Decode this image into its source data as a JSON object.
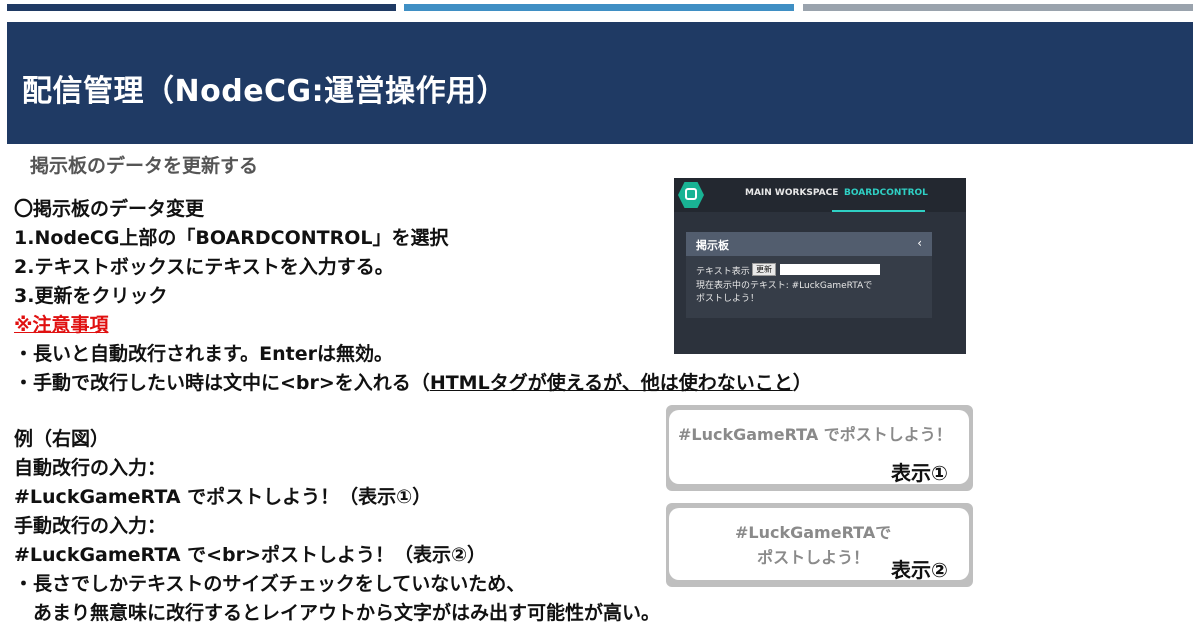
{
  "slide": {
    "title": "配信管理（NodeCG:運営操作用）",
    "subtitle": "掲示板のデータを更新する",
    "section_heading": "〇掲示板のデータ変更",
    "step1": "1.NodeCG上部の「BOARDCONTROL」を選択",
    "step2": "2.テキストボックスにテキストを入力する。",
    "step3": "3.更新をクリック",
    "caution": "※注意事項",
    "note1": "・長いと自動改行されます。Enterは無効。",
    "note2_prefix": "・手動で改行したい時は文中に<br>を入れる（",
    "note2_underlined": "HTMLタグが使えるが、他は使わないこと",
    "note2_suffix": "）",
    "example_heading": "例（右図）",
    "auto_label": "自動改行の入力：",
    "auto_input": "#LuckGameRTA でポストしよう！（表示①）",
    "manual_label": "手動改行の入力：",
    "manual_input": "#LuckGameRTA で<br>ポストしよう！（表示②）",
    "note3": "・長さでしかテキストのサイズチェックをしていないため、",
    "note4": "　あまり無意味に改行するとレイアウトから文字がはみ出す可能性が高い。"
  },
  "nodecg": {
    "tab_main": "MAIN WORKSPACE",
    "tab_board": "BOARDCONTROL",
    "panel_title": "掲示板",
    "panel_chevron": "‹",
    "text_display_label": "テキスト表示",
    "update_button": "更新",
    "current_text_line1": "現在表示中のテキスト: #LuckGameRTAで",
    "current_text_line2": "ポストしよう！",
    "accent_color": "#2fd0c4"
  },
  "examples": {
    "ex1_text": "#LuckGameRTA でポストしよう！",
    "ex1_label": "表示①",
    "ex2_line1": "#LuckGameRTAで",
    "ex2_line2": "ポストしよう！",
    "ex2_label": "表示②"
  },
  "colors": {
    "header": "#1f3a64",
    "bar_mid": "#3f8fc4",
    "bar_right": "#9aa3ad",
    "warning": "#e01010"
  }
}
